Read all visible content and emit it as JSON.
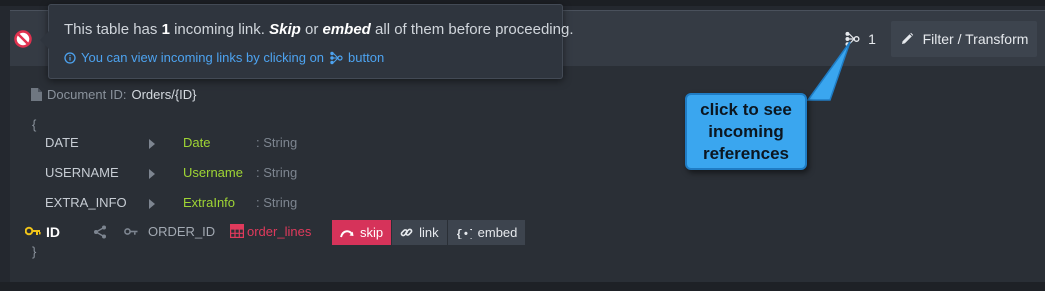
{
  "tooltip": {
    "message_pre": "This table has ",
    "count": "1",
    "message_mid1": " incoming link. ",
    "skip_word": "Skip",
    "or_word": " or ",
    "embed_word": "embed",
    "message_post": " all of them before proceeding.",
    "hint_pre": "You can view incoming links by clicking on",
    "hint_post": "button"
  },
  "toolbar": {
    "links_count": "1",
    "filter_label": "Filter / Transform"
  },
  "callout": {
    "line1": "click to see",
    "line2": "incoming",
    "line3": "references"
  },
  "document": {
    "id_label": "Document ID:",
    "id_value": "Orders/{ID}",
    "open_brace": "{",
    "close_brace": "}"
  },
  "fields": [
    {
      "name": "DATE",
      "target": "Date",
      "type": ": String"
    },
    {
      "name": "USERNAME",
      "target": "Username",
      "type": ": String"
    },
    {
      "name": "EXTRA_INFO",
      "target": "ExtraInfo",
      "type": ": String"
    }
  ],
  "id_row": {
    "primary_key": "ID",
    "foreign_key": "ORDER_ID",
    "table": "order_lines"
  },
  "actions": {
    "skip": "skip",
    "link": "link",
    "embed": "embed"
  },
  "colors": {
    "skip": "#d6335a",
    "mapped_field": "#9fd534",
    "table": "#e03a5c",
    "callout": "#3aa6ef",
    "hint": "#4da3f0",
    "key": "#f0c419"
  }
}
